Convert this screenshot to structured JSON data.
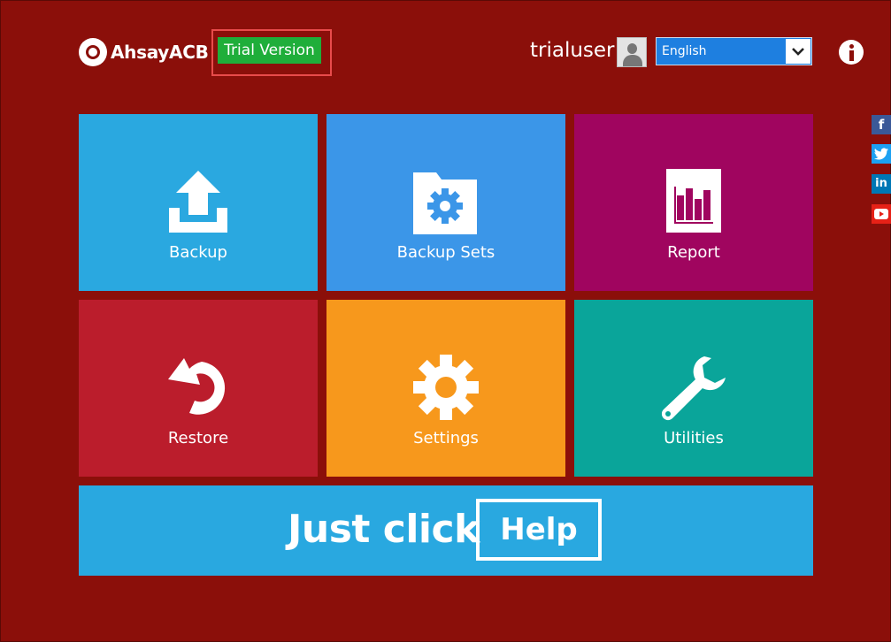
{
  "header": {
    "logo_text": "AhsayACB",
    "trial_label": "Trial Version",
    "username": "trialuser",
    "language": {
      "selected": "English"
    }
  },
  "social": [
    "facebook-icon",
    "twitter-icon",
    "linkedin-icon",
    "youtube-icon"
  ],
  "tiles": [
    {
      "label": "Backup",
      "color": "#2aa8e0",
      "icon": "upload-icon"
    },
    {
      "label": "Backup Sets",
      "color": "#3b96e8",
      "icon": "folder-gear-icon"
    },
    {
      "label": "Report",
      "color": "#a0055f",
      "icon": "report-chart-icon"
    },
    {
      "label": "Restore",
      "color": "#bb1d2c",
      "icon": "restore-icon"
    },
    {
      "label": "Settings",
      "color": "#f7981c",
      "icon": "gear-icon"
    },
    {
      "label": "Utilities",
      "color": "#0aa59a",
      "icon": "wrench-icon"
    }
  ],
  "help": {
    "text": "Just click",
    "button_label": "Help"
  }
}
